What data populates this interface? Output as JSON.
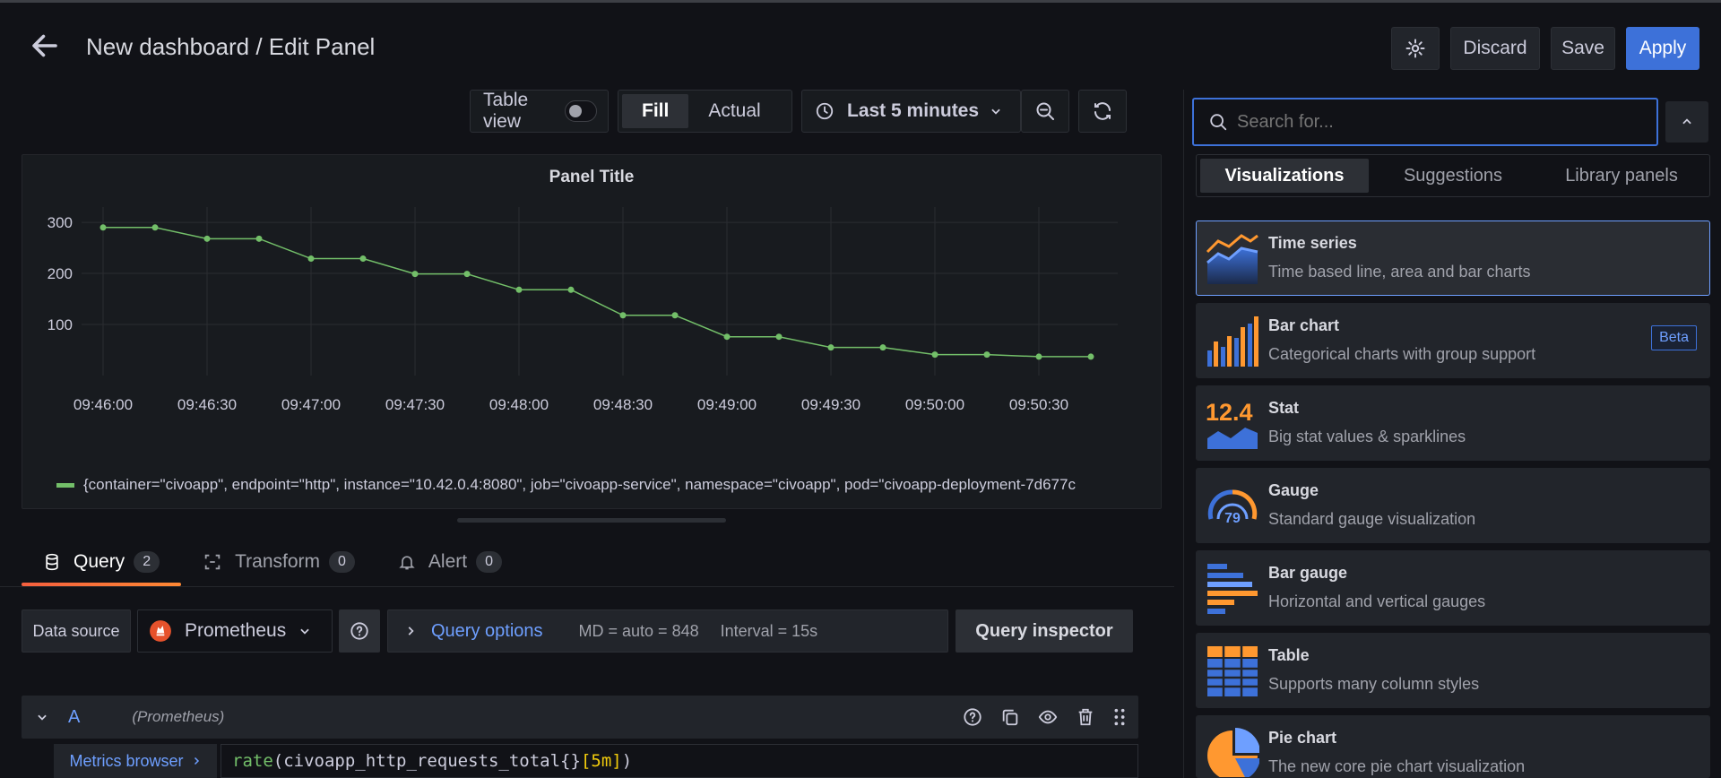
{
  "header": {
    "title": "New dashboard / Edit Panel",
    "discard": "Discard",
    "save": "Save",
    "apply": "Apply"
  },
  "toolbar": {
    "table_view": "Table view",
    "fill": "Fill",
    "actual": "Actual",
    "time_range": "Last 5 minutes"
  },
  "panel": {
    "title": "Panel Title",
    "legend": "{container=\"civoapp\", endpoint=\"http\", instance=\"10.42.0.4:8080\", job=\"civoapp-service\", namespace=\"civoapp\", pod=\"civoapp-deployment-7d677c"
  },
  "chart_data": {
    "type": "line",
    "title": "Panel Title",
    "x": [
      "09:46:00",
      "09:46:15",
      "09:46:30",
      "09:46:45",
      "09:47:00",
      "09:47:15",
      "09:47:30",
      "09:47:45",
      "09:48:00",
      "09:48:15",
      "09:48:30",
      "09:48:45",
      "09:49:00",
      "09:49:15",
      "09:49:30",
      "09:49:45",
      "09:50:00",
      "09:50:15",
      "09:50:30",
      "09:50:45"
    ],
    "x_ticks": [
      "09:46:00",
      "09:46:30",
      "09:47:00",
      "09:47:30",
      "09:48:00",
      "09:48:30",
      "09:49:00",
      "09:49:30",
      "09:50:00",
      "09:50:30"
    ],
    "y_ticks": [
      100,
      200,
      300
    ],
    "ylim": [
      0,
      330
    ],
    "series": [
      {
        "name": "{container=\"civoapp\", endpoint=\"http\", instance=\"10.42.0.4:8080\", job=\"civoapp-service\", namespace=\"civoapp\", pod=\"civoapp-deployment-7d677c",
        "color": "#73bf69",
        "values": [
          290,
          290,
          268,
          268,
          229,
          229,
          199,
          199,
          168,
          168,
          118,
          118,
          76,
          76,
          55,
          55,
          41,
          41,
          37,
          37
        ]
      }
    ],
    "grid": true,
    "legend_position": "bottom"
  },
  "tabs": [
    {
      "label": "Query",
      "count": "2"
    },
    {
      "label": "Transform",
      "count": "0"
    },
    {
      "label": "Alert",
      "count": "0"
    }
  ],
  "query": {
    "data_source_label": "Data source",
    "data_source": "Prometheus",
    "query_options": "Query options",
    "md": "MD = auto = 848",
    "interval": "Interval = 15s",
    "inspector": "Query inspector",
    "row_letter": "A",
    "row_source": "(Prometheus)",
    "metrics_browser": "Metrics browser",
    "expr_fn": "rate",
    "expr_body": "(civoapp_http_requests_total{}",
    "expr_range": "[5m]",
    "expr_close": ")"
  },
  "right": {
    "search_placeholder": "Search for...",
    "tabs": [
      "Visualizations",
      "Suggestions",
      "Library panels"
    ],
    "viz": [
      {
        "name": "Time series",
        "desc": "Time based line, area and bar charts"
      },
      {
        "name": "Bar chart",
        "desc": "Categorical charts with group support",
        "badge": "Beta"
      },
      {
        "name": "Stat",
        "desc": "Big stat values & sparklines",
        "icon_text": "12.4"
      },
      {
        "name": "Gauge",
        "desc": "Standard gauge visualization",
        "icon_text": "79"
      },
      {
        "name": "Bar gauge",
        "desc": "Horizontal and vertical gauges"
      },
      {
        "name": "Table",
        "desc": "Supports many column styles"
      },
      {
        "name": "Pie chart",
        "desc": "The new core pie chart visualization"
      }
    ]
  },
  "colors": {
    "accent": "#3d71d9",
    "series": "#73bf69",
    "tab_underline": "#ff8833"
  }
}
